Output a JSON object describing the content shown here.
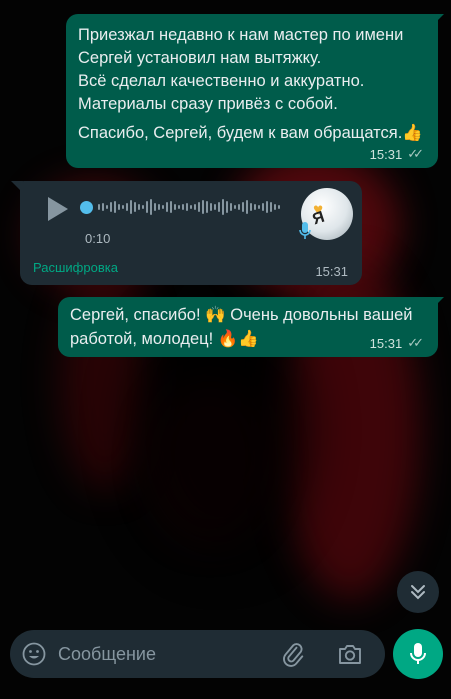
{
  "messages": [
    {
      "direction": "outgoing",
      "lines": [
        "Приезжал недавно к нам мастер по имени",
        "Сергей установил нам вытяжку.",
        "Всё сделал качественно и аккуратно.",
        "Материалы сразу привёз с собой."
      ],
      "closing": "Спасибо, Сергей, будем к вам обращатся.👍",
      "time": "15:31",
      "ticks": "✓✓"
    },
    {
      "direction": "incoming",
      "type": "voice",
      "duration": "0:10",
      "action_label": "Расшифровка",
      "time": "15:31",
      "avatar_icon": "heart-logo-icon"
    },
    {
      "direction": "outgoing",
      "line1": "Сергей, спасибо! 🙌 Очень довольны вашей",
      "line2": "работой, молодец! 🔥👍",
      "time": "15:31",
      "ticks": "✓✓"
    }
  ],
  "composer": {
    "placeholder": "Сообщение"
  },
  "colors": {
    "outgoing_bubble": "#005c4b",
    "incoming_bubble": "#1f2c34",
    "accent": "#00a884",
    "read_ticks": "#53bdeb"
  }
}
